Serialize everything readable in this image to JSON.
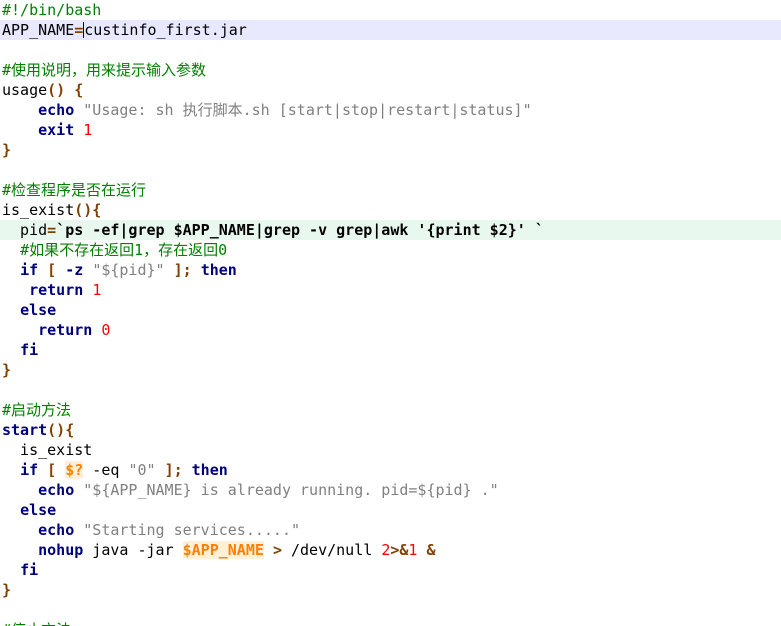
{
  "editor": {
    "language": "bash",
    "colors": {
      "comment": "#008000",
      "keyword": "#00007f",
      "brace": "#804000",
      "number": "#ff0000",
      "string": "#808080",
      "variable": "#ff8000",
      "current_line": "#e8e8ff",
      "highlight_line": "#e8f8ef"
    },
    "lines": [
      {
        "hl": "",
        "tokens": [
          {
            "t": "comment",
            "s": "#!/bin/bash"
          }
        ]
      },
      {
        "hl": "current",
        "tokens": [
          {
            "t": "plain",
            "s": "APP_NAME"
          },
          {
            "t": "op",
            "s": "="
          },
          {
            "t": "caret",
            "s": ""
          },
          {
            "t": "plain",
            "s": "custinfo_first.jar"
          }
        ]
      },
      {
        "hl": "",
        "tokens": []
      },
      {
        "hl": "",
        "tokens": [
          {
            "t": "comment",
            "s": "#使用说明，用来提示输入参数"
          }
        ]
      },
      {
        "hl": "",
        "tokens": [
          {
            "t": "plain",
            "s": "usage"
          },
          {
            "t": "brace",
            "s": "()"
          },
          {
            "t": "plain",
            "s": " "
          },
          {
            "t": "brace",
            "s": "{"
          }
        ]
      },
      {
        "hl": "",
        "tokens": [
          {
            "t": "plain",
            "s": "    "
          },
          {
            "t": "kw",
            "s": "echo"
          },
          {
            "t": "plain",
            "s": " "
          },
          {
            "t": "str",
            "s": "\"Usage: sh 执行脚本.sh [start|stop|restart|status]\""
          }
        ]
      },
      {
        "hl": "",
        "tokens": [
          {
            "t": "plain",
            "s": "    "
          },
          {
            "t": "kw",
            "s": "exit"
          },
          {
            "t": "plain",
            "s": " "
          },
          {
            "t": "num",
            "s": "1"
          }
        ]
      },
      {
        "hl": "",
        "tokens": [
          {
            "t": "brace",
            "s": "}"
          }
        ]
      },
      {
        "hl": "",
        "tokens": []
      },
      {
        "hl": "",
        "tokens": [
          {
            "t": "comment",
            "s": "#检查程序是否在运行"
          }
        ]
      },
      {
        "hl": "",
        "tokens": [
          {
            "t": "plain",
            "s": "is_exist"
          },
          {
            "t": "brace",
            "s": "(){"
          }
        ]
      },
      {
        "hl": "green",
        "tokens": [
          {
            "t": "plain",
            "s": "  pid"
          },
          {
            "t": "op",
            "s": "="
          },
          {
            "t": "bt",
            "s": "`ps -ef|grep $APP_NAME|grep -v grep|awk '{print $2}' `"
          }
        ]
      },
      {
        "hl": "",
        "tokens": [
          {
            "t": "plain",
            "s": "  "
          },
          {
            "t": "comment",
            "s": "#如果不存在返回1，存在返回0"
          }
        ]
      },
      {
        "hl": "",
        "tokens": [
          {
            "t": "plain",
            "s": "  "
          },
          {
            "t": "kw",
            "s": "if"
          },
          {
            "t": "plain",
            "s": " "
          },
          {
            "t": "op",
            "s": "["
          },
          {
            "t": "plain",
            "s": " "
          },
          {
            "t": "kw",
            "s": "-z"
          },
          {
            "t": "plain",
            "s": " "
          },
          {
            "t": "str",
            "s": "\"${pid}\""
          },
          {
            "t": "plain",
            "s": " "
          },
          {
            "t": "op",
            "s": "];"
          },
          {
            "t": "plain",
            "s": " "
          },
          {
            "t": "kw",
            "s": "then"
          }
        ]
      },
      {
        "hl": "",
        "tokens": [
          {
            "t": "plain",
            "s": "   "
          },
          {
            "t": "kw",
            "s": "return"
          },
          {
            "t": "plain",
            "s": " "
          },
          {
            "t": "num",
            "s": "1"
          }
        ]
      },
      {
        "hl": "",
        "tokens": [
          {
            "t": "plain",
            "s": "  "
          },
          {
            "t": "kw",
            "s": "else"
          }
        ]
      },
      {
        "hl": "",
        "tokens": [
          {
            "t": "plain",
            "s": "    "
          },
          {
            "t": "kw",
            "s": "return"
          },
          {
            "t": "plain",
            "s": " "
          },
          {
            "t": "num",
            "s": "0"
          }
        ]
      },
      {
        "hl": "",
        "tokens": [
          {
            "t": "plain",
            "s": "  "
          },
          {
            "t": "kw",
            "s": "fi"
          }
        ]
      },
      {
        "hl": "",
        "tokens": [
          {
            "t": "brace",
            "s": "}"
          }
        ]
      },
      {
        "hl": "",
        "tokens": []
      },
      {
        "hl": "",
        "tokens": [
          {
            "t": "comment",
            "s": "#启动方法"
          }
        ]
      },
      {
        "hl": "",
        "tokens": [
          {
            "t": "func",
            "s": "start"
          },
          {
            "t": "brace",
            "s": "(){"
          }
        ]
      },
      {
        "hl": "",
        "tokens": [
          {
            "t": "plain",
            "s": "  is_exist"
          }
        ]
      },
      {
        "hl": "",
        "tokens": [
          {
            "t": "plain",
            "s": "  "
          },
          {
            "t": "kw",
            "s": "if"
          },
          {
            "t": "plain",
            "s": " "
          },
          {
            "t": "op",
            "s": "["
          },
          {
            "t": "plain",
            "s": " "
          },
          {
            "t": "var",
            "s": "$?"
          },
          {
            "t": "plain",
            "s": " -eq "
          },
          {
            "t": "str",
            "s": "\"0\""
          },
          {
            "t": "plain",
            "s": " "
          },
          {
            "t": "op",
            "s": "];"
          },
          {
            "t": "plain",
            "s": " "
          },
          {
            "t": "kw",
            "s": "then"
          }
        ]
      },
      {
        "hl": "",
        "tokens": [
          {
            "t": "plain",
            "s": "    "
          },
          {
            "t": "kw",
            "s": "echo"
          },
          {
            "t": "plain",
            "s": " "
          },
          {
            "t": "str",
            "s": "\"${APP_NAME} is already running. pid=${pid} .\""
          }
        ]
      },
      {
        "hl": "",
        "tokens": [
          {
            "t": "plain",
            "s": "  "
          },
          {
            "t": "kw",
            "s": "else"
          }
        ]
      },
      {
        "hl": "",
        "tokens": [
          {
            "t": "plain",
            "s": "    "
          },
          {
            "t": "kw",
            "s": "echo"
          },
          {
            "t": "plain",
            "s": " "
          },
          {
            "t": "str",
            "s": "\"Starting services.....\""
          }
        ]
      },
      {
        "hl": "",
        "tokens": [
          {
            "t": "plain",
            "s": "    "
          },
          {
            "t": "kw",
            "s": "nohup"
          },
          {
            "t": "plain",
            "s": " java -jar "
          },
          {
            "t": "var",
            "s": "$APP_NAME"
          },
          {
            "t": "plain",
            "s": " "
          },
          {
            "t": "op",
            "s": ">"
          },
          {
            "t": "plain",
            "s": " /dev/null "
          },
          {
            "t": "num",
            "s": "2"
          },
          {
            "t": "op",
            "s": ">&"
          },
          {
            "t": "num",
            "s": "1"
          },
          {
            "t": "plain",
            "s": " "
          },
          {
            "t": "op",
            "s": "&"
          }
        ]
      },
      {
        "hl": "",
        "tokens": [
          {
            "t": "plain",
            "s": "  "
          },
          {
            "t": "kw",
            "s": "fi"
          }
        ]
      },
      {
        "hl": "",
        "tokens": [
          {
            "t": "brace",
            "s": "}"
          }
        ]
      },
      {
        "hl": "",
        "tokens": []
      },
      {
        "hl": "",
        "tokens": [
          {
            "t": "comment",
            "s": "#停止方法"
          }
        ]
      }
    ]
  }
}
